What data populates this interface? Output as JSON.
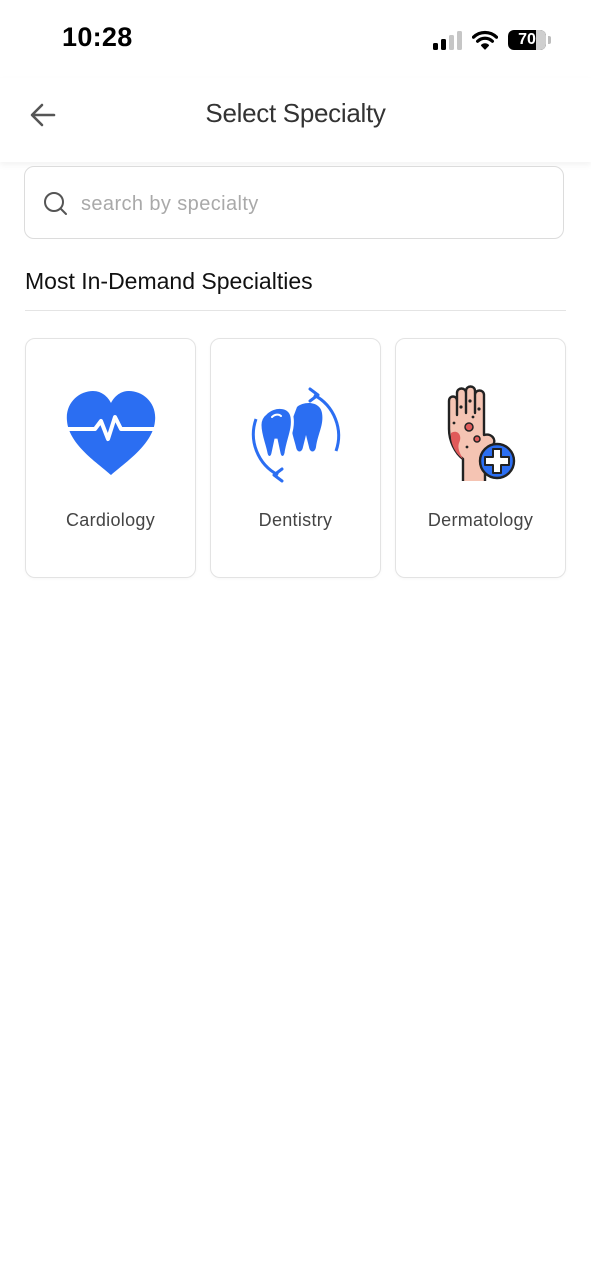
{
  "status_bar": {
    "time": "10:28",
    "battery": "70"
  },
  "header": {
    "title": "Select Specialty"
  },
  "search": {
    "placeholder": "search by specialty",
    "value": ""
  },
  "section": {
    "title": "Most In-Demand Specialties"
  },
  "specialties": [
    {
      "label": "Cardiology",
      "icon": "heart-pulse-icon"
    },
    {
      "label": "Dentistry",
      "icon": "teeth-icon"
    },
    {
      "label": "Dermatology",
      "icon": "skin-hand-icon"
    }
  ],
  "colors": {
    "accent": "#2b6ef2",
    "skin": "#f5c4b3",
    "rash": "#e05a5a",
    "text_primary": "#111111",
    "placeholder": "#a9a9a9"
  }
}
